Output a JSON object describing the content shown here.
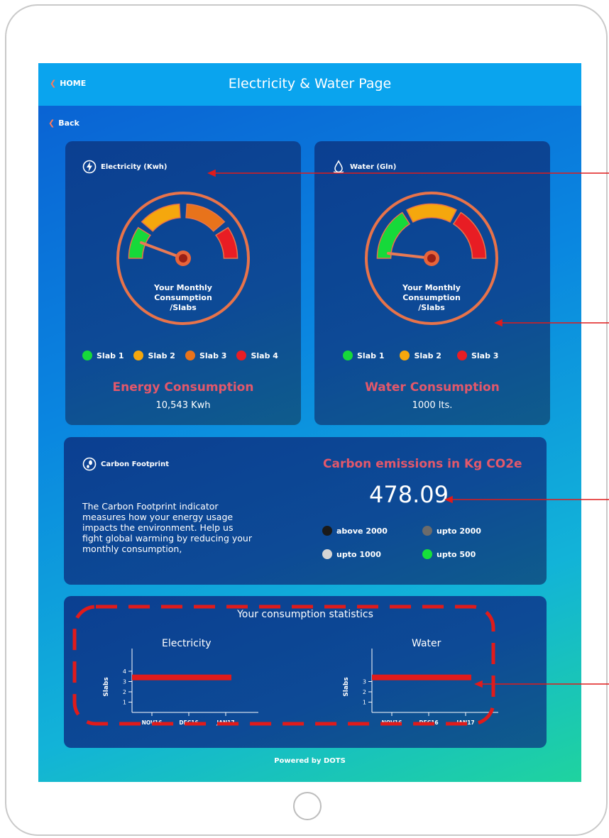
{
  "header": {
    "home_label": "HOME",
    "title": "Electricity & Water Page"
  },
  "nav": {
    "back_label": "Back"
  },
  "electricity": {
    "title": "Electricity (Kwh)",
    "gauge_label": [
      "Your Monthly",
      "Consumption",
      "/Slabs"
    ],
    "slabs": [
      {
        "label": "Slab 1",
        "color": "#16d93a"
      },
      {
        "label": "Slab 2",
        "color": "#f5a70d"
      },
      {
        "label": "Slab 3",
        "color": "#e8731b"
      },
      {
        "label": "Slab 4",
        "color": "#e81d24"
      }
    ],
    "consumption_title": "Energy Consumption",
    "consumption_value": "10,543 Kwh"
  },
  "water": {
    "title": "Water (Gln)",
    "gauge_label": [
      "Your Monthly",
      "Consumption",
      "/Slabs"
    ],
    "slabs": [
      {
        "label": "Slab 1",
        "color": "#16d93a"
      },
      {
        "label": "Slab 2",
        "color": "#f5a70d"
      },
      {
        "label": "Slab 3",
        "color": "#e81d24"
      }
    ],
    "consumption_title": "Water Consumption",
    "consumption_value": "1000 lts."
  },
  "carbon": {
    "title": "Carbon Footprint",
    "description": "The Carbon Footprint indicator measures how your energy usage impacts the environment. Help us fight global warming by reducing your monthly consumption,",
    "emissions_title": "Carbon emissions in Kg CO2e",
    "emissions_value": "478.09",
    "legend": [
      {
        "label": "above 2000",
        "color": "#1a1a1a"
      },
      {
        "label": "upto 2000",
        "color": "#6b6b6b"
      },
      {
        "label": "upto 1000",
        "color": "#d5d5d5"
      },
      {
        "label": "upto 500",
        "color": "#16e03a"
      }
    ]
  },
  "stats": {
    "title": "Your consumption statistics",
    "charts": [
      {
        "title": "Electricity",
        "ylabel": "Slabs"
      },
      {
        "title": "Water",
        "ylabel": "Slabs"
      }
    ]
  },
  "chart_data": [
    {
      "type": "bar",
      "title": "Electricity",
      "ylabel": "Slabs",
      "ylim": [
        0,
        4.5
      ],
      "yticks": [
        "1",
        "2",
        "3",
        "4"
      ],
      "categories": [
        "NOV16",
        "DEC16",
        "JAN17"
      ],
      "values": [
        3.4,
        3.4,
        3.4
      ]
    },
    {
      "type": "bar",
      "title": "Water",
      "ylabel": "Slabs",
      "ylim": [
        0,
        3.5
      ],
      "yticks": [
        "1",
        "2",
        "3"
      ],
      "categories": [
        "NOV16",
        "DEC16",
        "JAN17"
      ],
      "values": [
        3.4,
        3.4,
        3.4
      ]
    }
  ],
  "footer": {
    "powered_prefix": "Powered by",
    "powered_brand": "DOTS"
  },
  "colors": {
    "accent_red": "#e3586b",
    "annotation": "#e01b1b",
    "topbar": "#0aa4ee"
  }
}
